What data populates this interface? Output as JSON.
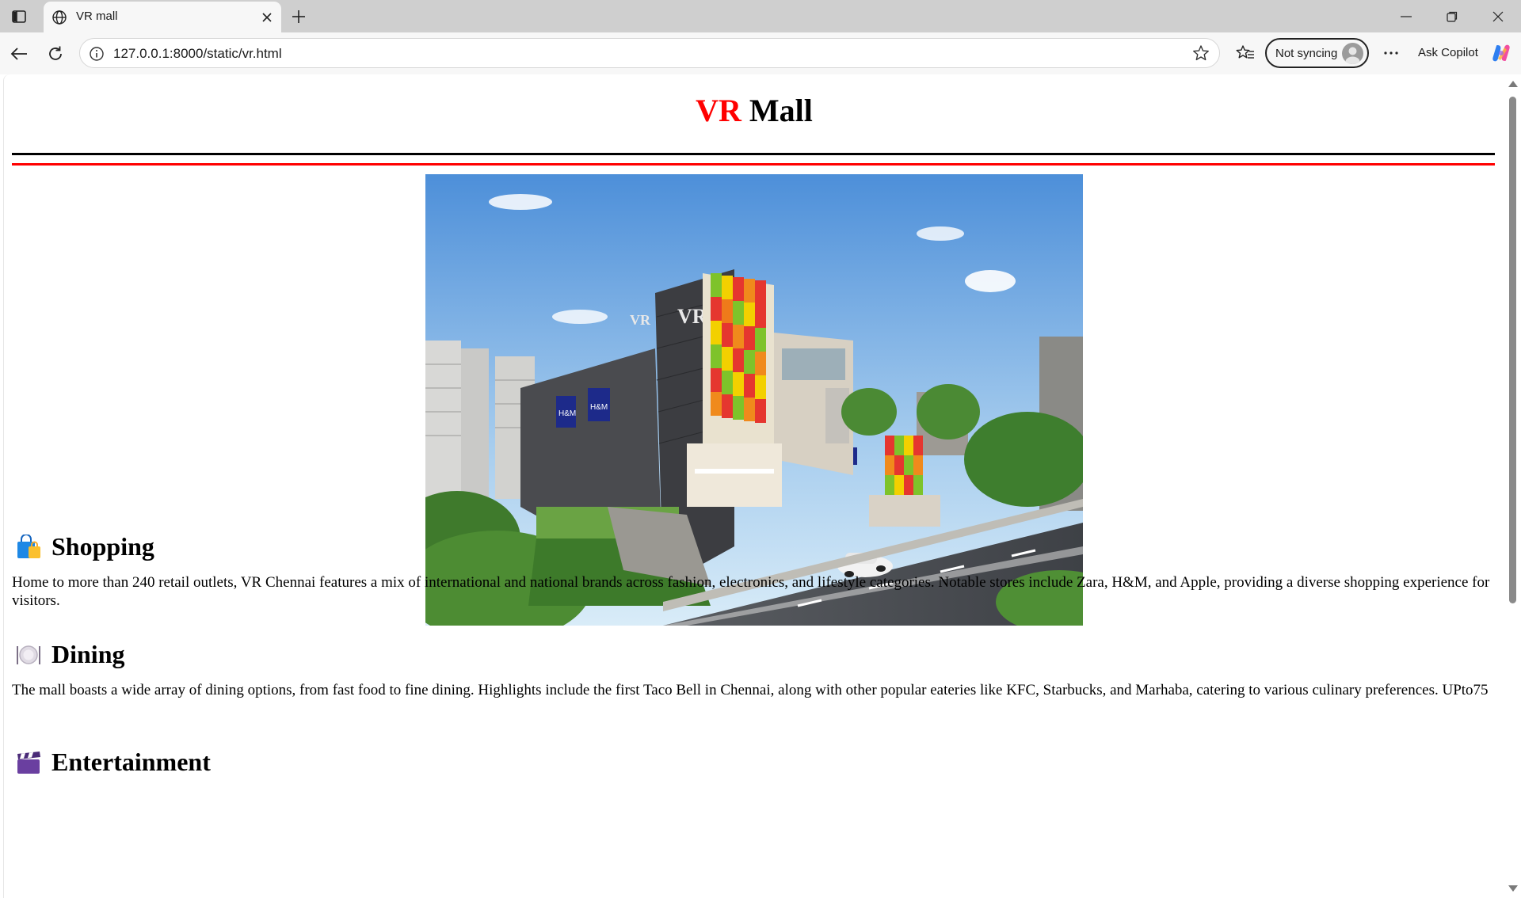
{
  "browser": {
    "tab_title": "VR mall",
    "url": "127.0.0.1:8000/static/vr.html",
    "sync_label": "Not syncing",
    "copilot_label": "Ask Copilot",
    "icons": {
      "sidebar": "sidebar-toggle-icon",
      "favicon": "globe-icon",
      "close_tab": "close-icon",
      "new_tab": "plus-icon",
      "back": "back-arrow-icon",
      "reload": "reload-icon",
      "info": "info-icon",
      "favorite": "star-icon",
      "favorites": "favorites-icon",
      "more": "more-icon",
      "copilot": "copilot-icon"
    }
  },
  "page": {
    "title_part1": "VR",
    "title_part2": " Mall",
    "colors": {
      "accent": "#ff0000",
      "rule_top": "#000000",
      "rule_bottom": "#ff0000"
    },
    "sections": [
      {
        "emoji": "🛍️",
        "heading": "Shopping",
        "text": "Home to more than 240 retail outlets, VR Chennai features a mix of international and national brands across fashion, electronics, and lifestyle categories. Notable stores include Zara, H&M, and Apple, providing a diverse shopping experience for visitors."
      },
      {
        "emoji": "🍽️",
        "heading": "Dining",
        "text": "The mall boasts a wide array of dining options, from fast food to fine dining. Highlights include the first Taco Bell in Chennai, along with other popular eateries like KFC, Starbucks, and Marhaba, catering to various culinary preferences. UPto75"
      },
      {
        "emoji": "🎬",
        "heading": "Entertainment",
        "text": ""
      }
    ]
  }
}
